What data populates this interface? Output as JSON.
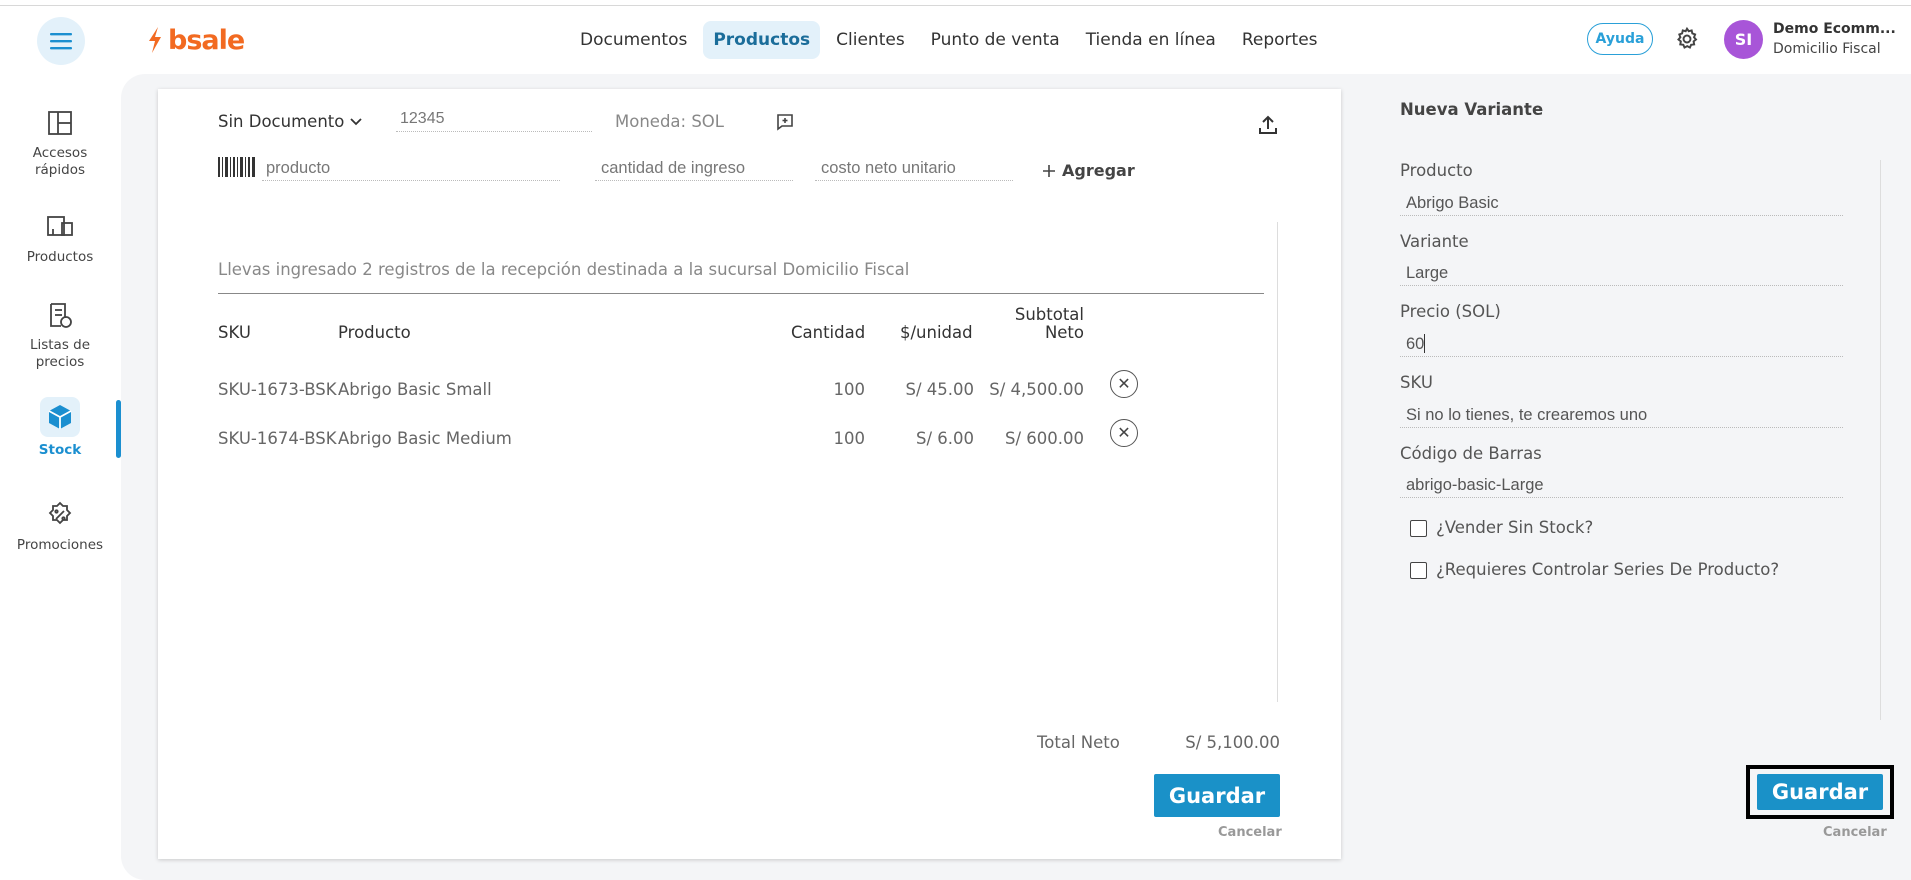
{
  "header": {
    "logo_text": "bsale",
    "nav": [
      "Documentos",
      "Productos",
      "Clientes",
      "Punto de venta",
      "Tienda en línea",
      "Reportes"
    ],
    "active_nav": "Productos",
    "help_label": "Ayuda",
    "user_initials": "SI",
    "user_name": "Demo Ecomm...",
    "user_branch": "Domicilio Fiscal"
  },
  "sidebar": {
    "items": [
      {
        "label_1": "Accesos",
        "label_2": "rápidos",
        "icon": "dashboard-icon"
      },
      {
        "label_1": "Productos",
        "label_2": "",
        "icon": "products-icon"
      },
      {
        "label_1": "Listas de",
        "label_2": "precios",
        "icon": "price-list-icon"
      },
      {
        "label_1": "Stock",
        "label_2": "",
        "icon": "stock-box-icon"
      },
      {
        "label_1": "Promociones",
        "label_2": "",
        "icon": "promotions-icon"
      }
    ],
    "active": "Stock"
  },
  "reception": {
    "document_type": "Sin Documento",
    "document_number_placeholder": "12345",
    "currency": "Moneda: SOL",
    "product_placeholder": "producto",
    "quantity_placeholder": "cantidad de ingreso",
    "unit_cost_placeholder": "costo neto unitario",
    "add_label": "Agregar",
    "info": "Llevas ingresado 2 registros de la recepción destinada a la sucursal Domicilio Fiscal",
    "columns": {
      "sku": "SKU",
      "product": "Producto",
      "quantity": "Cantidad",
      "unit_price": "$/unidad",
      "subtotal_1": "Subtotal",
      "subtotal_2": "Neto"
    },
    "rows": [
      {
        "sku": "SKU-1673-BSK",
        "product": "Abrigo Basic Small",
        "quantity": "100",
        "unit_price": "S/ 45.00",
        "subtotal": "S/ 4,500.00"
      },
      {
        "sku": "SKU-1674-BSK",
        "product": "Abrigo Basic Medium",
        "quantity": "100",
        "unit_price": "S/ 6.00",
        "subtotal": "S/ 600.00"
      }
    ],
    "total_label": "Total Neto",
    "total_value": "S/ 5,100.00",
    "save_label": "Guardar",
    "cancel_label": "Cancelar"
  },
  "variant_panel": {
    "title": "Nueva Variante",
    "product_label": "Producto",
    "product_value": "Abrigo Basic",
    "variant_label": "Variante",
    "variant_value": "Large",
    "price_label": "Precio (SOL)",
    "price_value": "60",
    "sku_label": "SKU",
    "sku_placeholder": "Si no lo tienes, te crearemos uno",
    "barcode_label": "Código de Barras",
    "barcode_value": "abrigo-basic-Large",
    "sell_without_stock_label": "¿Vender Sin Stock?",
    "control_series_label": "¿Requieres Controlar Series De Producto?",
    "save_label": "Guardar",
    "cancel_label": "Cancelar"
  }
}
